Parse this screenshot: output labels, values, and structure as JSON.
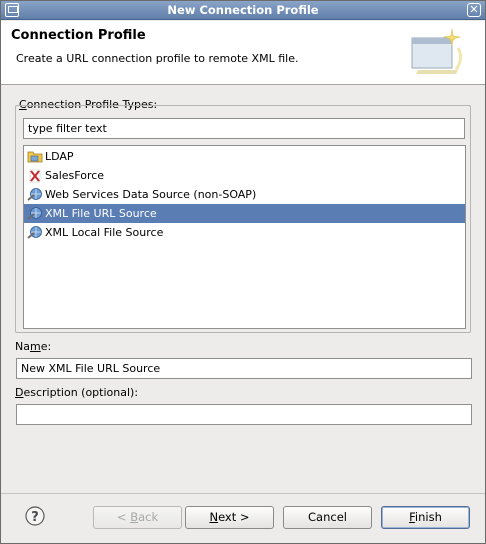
{
  "window": {
    "title": "New Connection Profile"
  },
  "header": {
    "title": "Connection Profile",
    "description": "Create a URL connection profile to remote XML file."
  },
  "profile_types": {
    "label_mnemonic": "C",
    "label_rest": "onnection Profile Types:",
    "filter_placeholder": "type filter text",
    "items": [
      {
        "label": "LDAP",
        "icon": "ldap-folder-icon",
        "selected": false
      },
      {
        "label": "SalesForce",
        "icon": "salesforce-icon",
        "selected": false
      },
      {
        "label": "Web Services Data Source (non-SOAP)",
        "icon": "web-services-icon",
        "selected": false
      },
      {
        "label": "XML File URL Source",
        "icon": "xml-url-icon",
        "selected": true
      },
      {
        "label": "XML Local File Source",
        "icon": "xml-local-icon",
        "selected": false
      }
    ]
  },
  "name_field": {
    "label_pre": "Na",
    "label_mnemonic": "m",
    "label_post": "e:",
    "value": "New XML File URL Source"
  },
  "description_field": {
    "label_mnemonic": "D",
    "label_rest": "escription (optional):",
    "value": ""
  },
  "buttons": {
    "back_pre": "< ",
    "back_mnemonic": "B",
    "back_post": "ack",
    "next_mnemonic": "N",
    "next_post": "ext >",
    "cancel": "Cancel",
    "finish_mnemonic": "F",
    "finish_post": "inish"
  },
  "colors": {
    "selection": "#5a7eb3",
    "titlebar": "#6f8db6"
  }
}
